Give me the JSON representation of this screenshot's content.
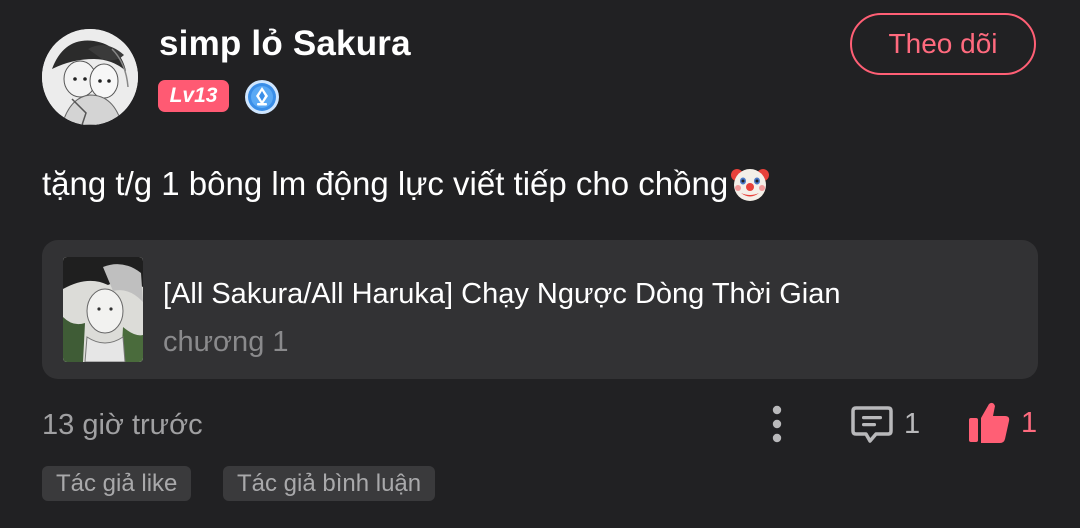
{
  "author": {
    "name": "simp lỏ Sakura",
    "level": "Lv13",
    "follow_label": "Theo dõi",
    "avatar_icon": "avatar-illustration",
    "verify_icon": "verified-pen-badge-icon"
  },
  "comment": {
    "text": "tặng t/g 1 bông lm động lực viết tiếp cho chồng",
    "emoji": "clown-face-icon"
  },
  "story": {
    "title": "[All Sakura/All Haruka] Chạy Ngược Dòng Thời Gian",
    "chapter": "chương 1",
    "cover_icon": "story-cover-illustration"
  },
  "footer": {
    "timestamp": "13 giờ trước",
    "comment_count": "1",
    "like_count": "1",
    "tags": [
      {
        "label": "Tác giả like"
      },
      {
        "label": "Tác giả bình luận"
      }
    ]
  },
  "colors": {
    "background": "#212123",
    "card": "#323234",
    "accent": "#ff5f75",
    "muted_text": "#8a8a8c"
  }
}
